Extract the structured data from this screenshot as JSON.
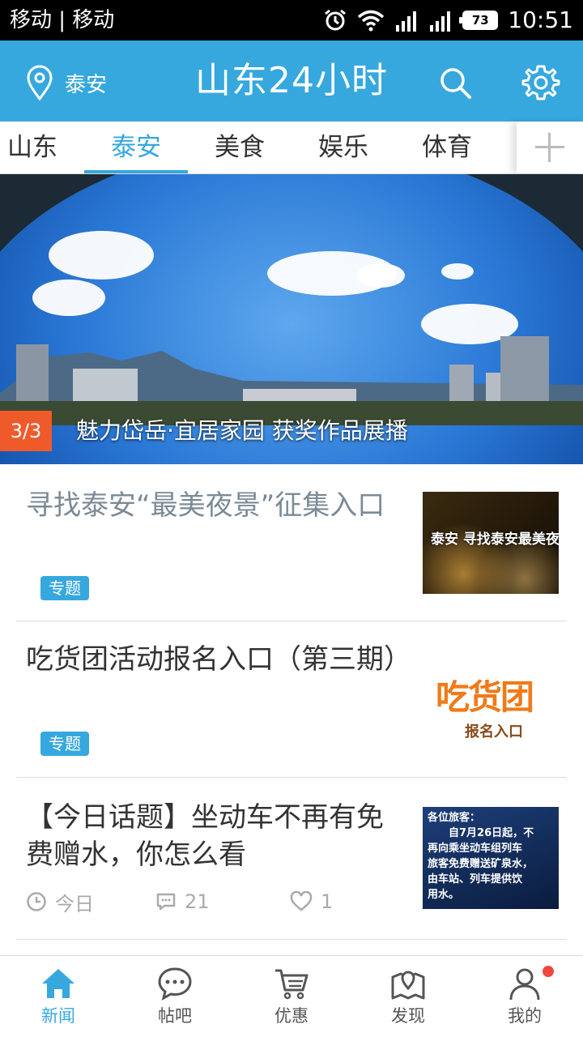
{
  "status_bar": {
    "carrier": "移动 | 移动",
    "battery": "73",
    "time": "10:51"
  },
  "header": {
    "location": "泰安",
    "title": "山东24小时"
  },
  "tabs": [
    {
      "label": "山东"
    },
    {
      "label": "泰安",
      "active": true
    },
    {
      "label": "美食"
    },
    {
      "label": "娱乐"
    },
    {
      "label": "体育"
    }
  ],
  "banner": {
    "counter": "3/3",
    "caption": "魅力岱岳·宜居家园 获奖作品展播"
  },
  "feed": [
    {
      "title": "寻找泰安“最美夜景”征集入口",
      "tag": "专题",
      "read": true,
      "thumb_text": "泰安 寻找泰安最美夜"
    },
    {
      "title": "吃货团活动报名入口（第三期）",
      "tag": "专题",
      "thumb_text_big": "吃货团",
      "thumb_text_small": "报名入口"
    },
    {
      "title": "【今日话题】坐动车不再有免费赠水，你怎么看",
      "meta": {
        "time": "今日",
        "comments": "21",
        "likes": "1"
      },
      "thumb_lines": [
        "各位旅客：",
        "自7月26日起，不",
        "再向乘坐动车组列车",
        "旅客免费赠送矿泉水，",
        "由车站、列车提供饮",
        "用水。"
      ]
    }
  ],
  "bottom_nav": [
    {
      "label": "新闻",
      "icon": "home-icon",
      "active": true
    },
    {
      "label": "帖吧",
      "icon": "chat-icon"
    },
    {
      "label": "优惠",
      "icon": "cart-icon"
    },
    {
      "label": "发现",
      "icon": "map-icon"
    },
    {
      "label": "我的",
      "icon": "person-icon",
      "badge": true
    }
  ],
  "colors": {
    "primary": "#36a8de",
    "counter": "#ef5a2a",
    "badge": "#f0483e"
  }
}
